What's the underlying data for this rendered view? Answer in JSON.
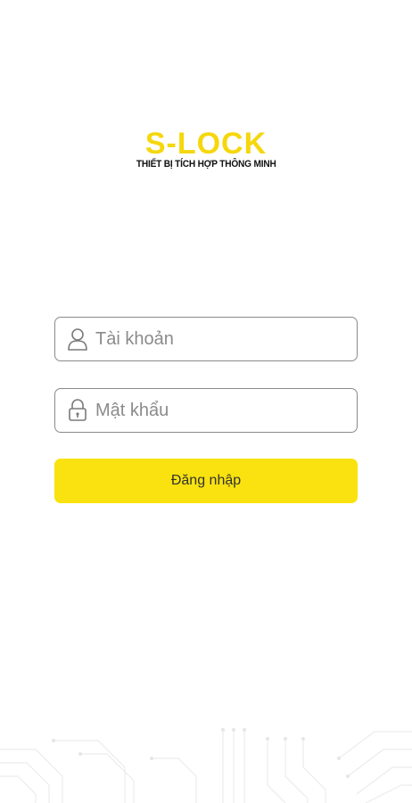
{
  "logo": {
    "brand": "S-LOCK",
    "tagline": "THIẾT BỊ TÍCH HỢP THÔNG MINH",
    "brand_color": "#F5D70C"
  },
  "form": {
    "username": {
      "placeholder": "Tài khoản",
      "value": "",
      "icon": "user-icon"
    },
    "password": {
      "placeholder": "Mật khẩu",
      "value": "",
      "icon": "lock-icon"
    },
    "login_label": "Đăng nhập",
    "button_color": "#F9E20F"
  }
}
